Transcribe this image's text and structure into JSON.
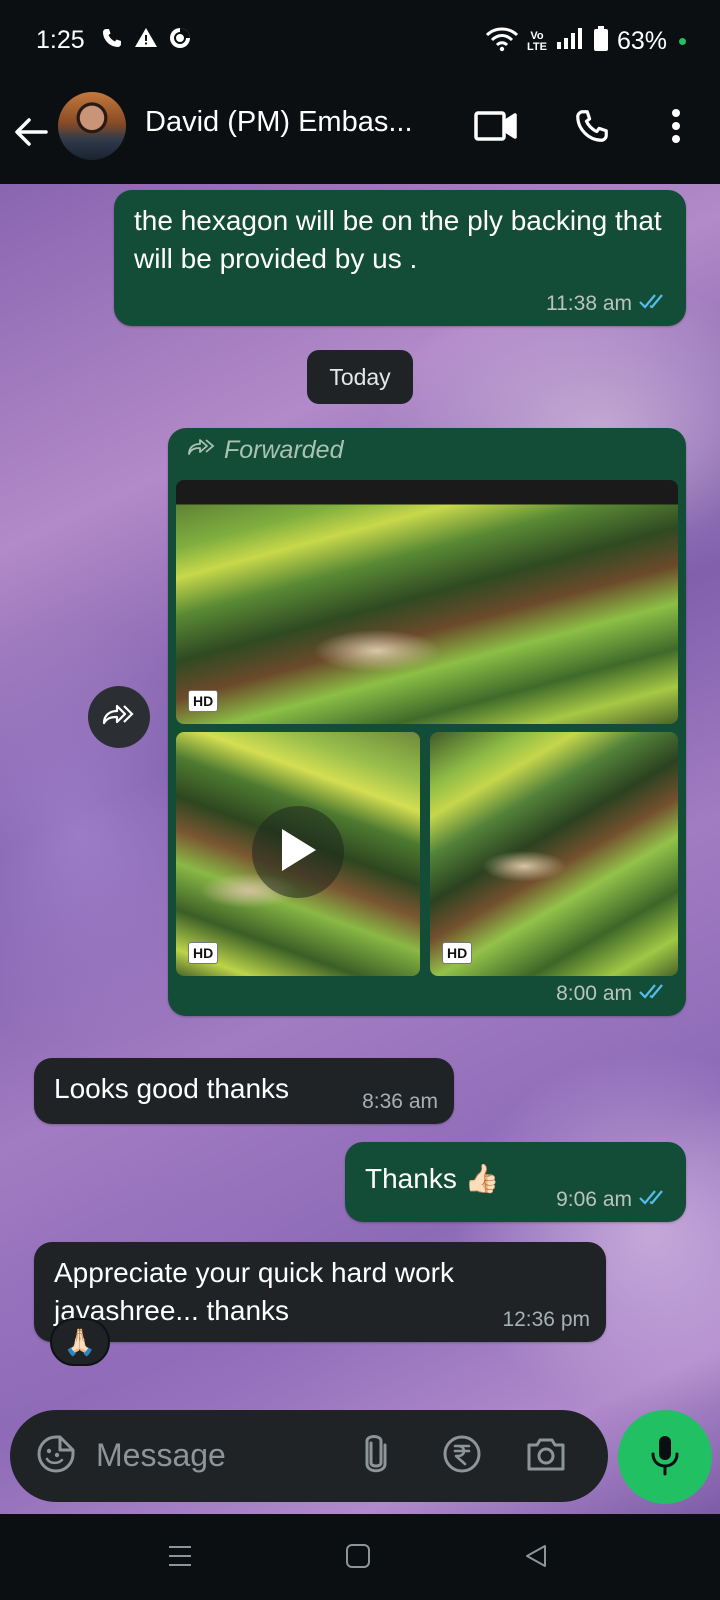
{
  "status_bar": {
    "time": "1:25",
    "network_label_top": "Vo",
    "network_label_bottom": "LTE",
    "battery_percent": "63%",
    "icons": [
      "phone-icon",
      "alert-icon",
      "vpn-icon",
      "wifi-icon",
      "signal-icon",
      "battery-icon"
    ]
  },
  "header": {
    "contact_name": "David (PM) Embas...",
    "icons": [
      "back-arrow-icon",
      "video-call-icon",
      "voice-call-icon",
      "more-options-icon"
    ]
  },
  "messages": [
    {
      "direction": "out",
      "text": "the hexagon will be on the ply backing that will be provided by us .",
      "time": "11:38 am",
      "status": "read"
    },
    {
      "direction": "out",
      "type": "media-album",
      "forwarded_label": "Forwarded",
      "media": [
        {
          "kind": "image",
          "badge": "HD"
        },
        {
          "kind": "video",
          "badge": "HD"
        },
        {
          "kind": "image",
          "badge": "HD"
        }
      ],
      "time": "8:00 am",
      "status": "read"
    },
    {
      "direction": "in",
      "text": "Looks good thanks",
      "time": "8:36 am"
    },
    {
      "direction": "out",
      "text": "Thanks 👍🏻",
      "time": "9:06 am",
      "status": "read"
    },
    {
      "direction": "in",
      "text": "Appreciate your quick hard work jayashree... thanks",
      "time": "12:36 pm",
      "reaction": "🙏🏻"
    }
  ],
  "date_divider": "Today",
  "composer": {
    "placeholder": "Message",
    "icons": [
      "sticker-icon",
      "attach-icon",
      "rupee-payment-icon",
      "camera-icon",
      "mic-icon"
    ]
  },
  "colors": {
    "outgoing_bubble": "#144d37",
    "incoming_bubble": "#1f2326",
    "accent": "#21c063",
    "read_ticks": "#53bdeb"
  }
}
